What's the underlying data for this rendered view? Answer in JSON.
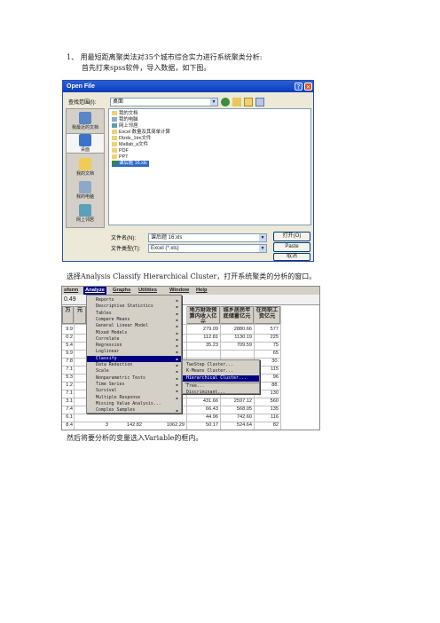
{
  "step_heading": "1、 用最短距离聚类法对35个城市综合实力进行系统聚类分析:",
  "step_intro": "首先打来spss软件，导入数据，如下图。",
  "dialog": {
    "title": "Open File",
    "look_in_label": "查找范围(I):",
    "look_in_value": "桌面",
    "places": [
      "我最近的文档",
      "桌面",
      "我的文档",
      "我的电脑",
      "网上邻居"
    ],
    "files": [
      "我的文档",
      "我的电脑",
      "网上邻居",
      "Excel 数量及其简单计算",
      "Dlzds_1tm文件",
      "Matlab_a文件",
      "PDF",
      "PPT",
      "课后题 16.xls"
    ],
    "file_name_label": "文件名(N):",
    "file_name_value": "课后题 16.xls",
    "file_type_label": "文件类型(T):",
    "file_type_value": "Excel (*.xls)",
    "open_button": "打开(O)",
    "paste_button": "Paste",
    "cancel_button": "取消"
  },
  "menu_caption": "选择Analysis  Classify  Hierarchical Cluster，打开系统聚类的分析的窗口。",
  "spss": {
    "menubar": [
      "sform",
      "Analyze",
      "Graphs",
      "Utilities",
      "Window",
      "Help"
    ],
    "analyze_items": [
      "Reports",
      "Descriptive Statistics",
      "Tables",
      "Compare Means",
      "General Linear Model",
      "Mixed Models",
      "Correlate",
      "Regression",
      "Loglinear",
      "Classify",
      "Data Reduction",
      "Scale",
      "Nonparametric Tests",
      "Time Series",
      "Survival",
      "Multiple Response",
      "Missing Value Analysis...",
      "Complex Samples"
    ],
    "classify_items": [
      "TwoStep Cluster...",
      "K-Means Cluster...",
      "Hierarchical Cluster...",
      "Tree...",
      "Discriminant..."
    ],
    "cell_ref": "0.49",
    "headers": [
      "万",
      "元",
      "地方财政预算内收入亿元",
      "城乡居民年底储蓄亿元",
      "在岗职工资亿元"
    ],
    "left_col": [
      "9.9",
      "0.2",
      "5.4",
      "9.9",
      "7.8",
      "7.1",
      "5.3",
      "1.2",
      "7.1",
      "3.1",
      "7.4",
      "6.1",
      "8.4"
    ],
    "rows": [
      [
        "",
        "",
        "279.09",
        "2880.66",
        "577"
      ],
      [
        "",
        "",
        "112.81",
        "1130.19",
        "225"
      ],
      [
        "",
        "",
        "35.23",
        "709.59",
        "75"
      ],
      [
        "",
        "",
        "",
        "",
        "65"
      ],
      [
        "",
        "",
        "",
        "",
        "30."
      ],
      [
        "",
        "",
        "",
        "",
        "115"
      ],
      [
        "",
        "",
        "",
        "",
        "96"
      ],
      [
        "",
        "",
        "",
        "",
        "88."
      ],
      [
        "",
        "",
        "",
        "845.00",
        "130"
      ],
      [
        "",
        "",
        "431.66",
        "2597.12",
        "560"
      ],
      [
        "",
        "",
        "66.43",
        "568.05",
        "135"
      ],
      [
        "",
        "",
        "44.96",
        "742.60",
        "116"
      ],
      [
        "3",
        "142.82",
        "1062.29",
        "50.17",
        "524.64",
        "82"
      ]
    ]
  },
  "next_caption": "然后将要分析的变量选入Variable的框内。"
}
